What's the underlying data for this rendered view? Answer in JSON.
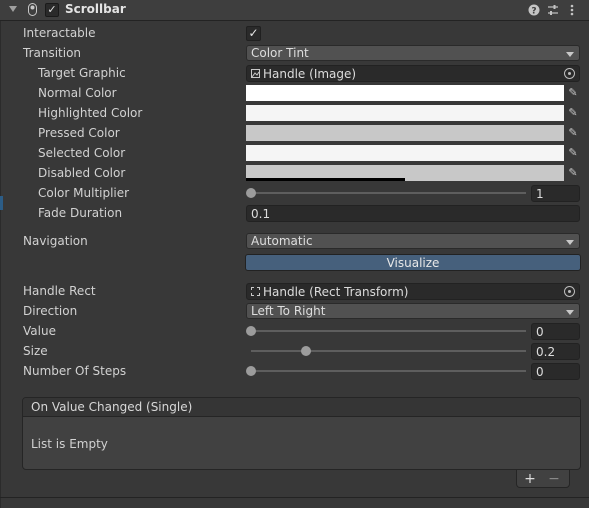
{
  "component": {
    "title": "Scrollbar",
    "enabled": true,
    "icons": [
      "help-icon",
      "preset-icon",
      "more-icon"
    ]
  },
  "fields": {
    "interactable_label": "Interactable",
    "interactable_checked": true,
    "transition_label": "Transition",
    "transition_value": "Color Tint",
    "target_graphic_label": "Target Graphic",
    "target_graphic_value": "Handle (Image)",
    "normal_color_label": "Normal Color",
    "normal_color": "#ffffff",
    "highlighted_color_label": "Highlighted Color",
    "highlighted_color": "#f5f5f5",
    "pressed_color_label": "Pressed Color",
    "pressed_color": "#c8c8c8",
    "selected_color_label": "Selected Color",
    "selected_color": "#f5f5f5",
    "disabled_color_label": "Disabled Color",
    "disabled_color": "#c8c8c8",
    "disabled_alpha": 0.5,
    "color_multiplier_label": "Color Multiplier",
    "color_multiplier_value": "1",
    "color_multiplier_fraction": 0,
    "fade_duration_label": "Fade Duration",
    "fade_duration_value": "0.1",
    "navigation_label": "Navigation",
    "navigation_value": "Automatic",
    "visualize_label": "Visualize",
    "handle_rect_label": "Handle Rect",
    "handle_rect_value": "Handle (Rect Transform)",
    "direction_label": "Direction",
    "direction_value": "Left To Right",
    "value_label": "Value",
    "value_value": "0",
    "value_fraction": 0,
    "size_label": "Size",
    "size_value": "0.2",
    "size_fraction": 0.2,
    "steps_label": "Number Of Steps",
    "steps_value": "0",
    "steps_fraction": 0
  },
  "event": {
    "title": "On Value Changed (Single)",
    "empty_text": "List is Empty",
    "add_label": "+",
    "remove_label": "−"
  },
  "colors": {
    "background": "#383838",
    "accent": "#46607c"
  }
}
